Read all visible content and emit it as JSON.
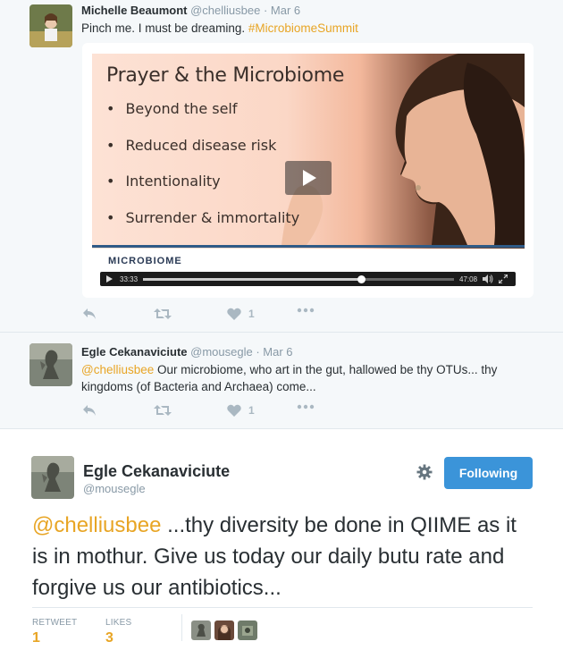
{
  "tweet1": {
    "name": "Michelle Beaumont",
    "handle": "@chelliusbee",
    "date": "· Mar 6",
    "text": "Pinch me. I must be dreaming. ",
    "hashtag": "#MicrobiomeSummit",
    "video": {
      "slide_title": "Prayer & the Microbiome",
      "bullets": [
        "Beyond the self",
        "Reduced disease risk",
        "Intentionality",
        "Surrender & immortality"
      ],
      "brand": "MICROBIOME",
      "elapsed": "33:33",
      "duration": "47:08",
      "progress": 0.7
    },
    "likes": "1"
  },
  "tweet2": {
    "name": "Egle Cekanaviciute",
    "handle": "@mousegle",
    "date": "· Mar 6",
    "mention": "@chelliusbee",
    "text": " Our microbiome, who art in the gut, hallowed be thy OTUs... thy kingdoms (of Bacteria and Archaea) come...",
    "likes": "1"
  },
  "main": {
    "name": "Egle Cekanaviciute",
    "handle": "@mousegle",
    "follow_label": "Following",
    "mention": "@chelliusbee",
    "text": " ...thy diversity be done in QIIME as it is in mothur. Give us today our daily butu rate and forgive us our antibiotics...",
    "retweet_label": "RETWEET",
    "retweet_count": "1",
    "likes_label": "LIKES",
    "likes_count": "3"
  },
  "colors": {
    "hashtag": "#e8a525",
    "follow_button": "#3b94d9",
    "icon": "#aab8c2",
    "meta": "#8899a6"
  }
}
